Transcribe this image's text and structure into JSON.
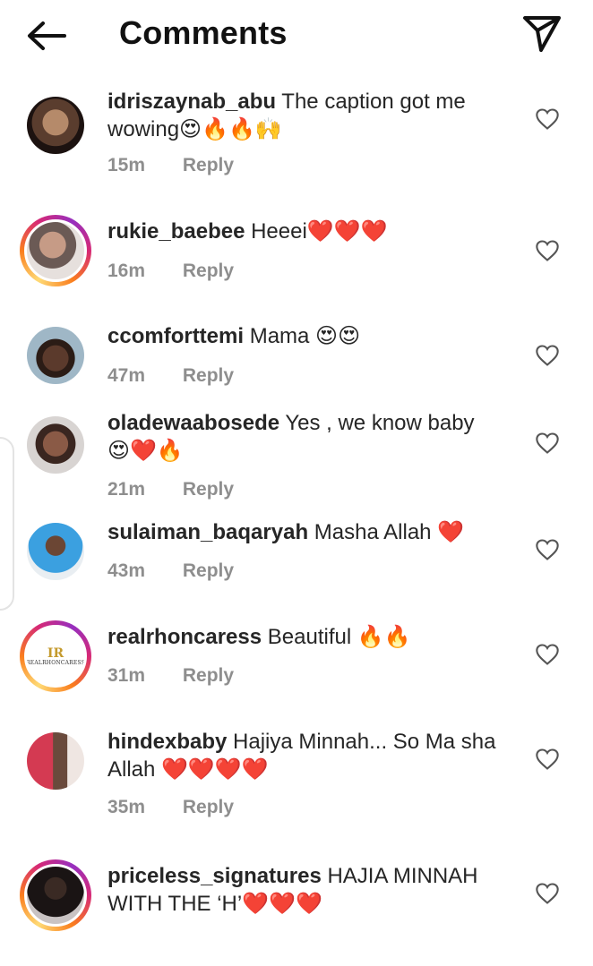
{
  "header": {
    "title": "Comments"
  },
  "comments": [
    {
      "username": "idriszaynab_abu",
      "text": "The caption got me wowing😍🔥🔥🙌",
      "time": "15m",
      "reply": "Reply"
    },
    {
      "username": "rukie_baebee",
      "text": "Heeei❤️❤️❤️",
      "time": "16m",
      "reply": "Reply"
    },
    {
      "username": "ccomforttemi",
      "text": "Mama 😍😍",
      "time": "47m",
      "reply": "Reply"
    },
    {
      "username": "oladewaabosede",
      "text": "Yes , we know baby 😍❤️🔥",
      "time": "21m",
      "reply": "Reply"
    },
    {
      "username": "sulaiman_baqaryah",
      "text": "Masha Allah ❤️",
      "time": "43m",
      "reply": "Reply"
    },
    {
      "username": "realrhoncaress",
      "text": "Beautiful 🔥🔥",
      "time": "31m",
      "reply": "Reply",
      "avatar_logo": "IR",
      "avatar_logo_text": "REALRHONCARESS"
    },
    {
      "username": "hindexbaby",
      "text": "Hajiya Minnah... So Ma sha Allah ❤️❤️❤️❤️",
      "time": "35m",
      "reply": "Reply"
    },
    {
      "username": "priceless_signatures",
      "text": "HAJIA MINNAH WITH THE ‘H’❤️❤️❤️",
      "time": "",
      "reply": ""
    }
  ],
  "colors": {
    "text": "#262626",
    "meta": "#8e8e8e",
    "ring_start": "#feda75",
    "ring_end": "#962fbf"
  },
  "icons": [
    "back-arrow-icon",
    "send-icon",
    "heart-outline-icon"
  ]
}
